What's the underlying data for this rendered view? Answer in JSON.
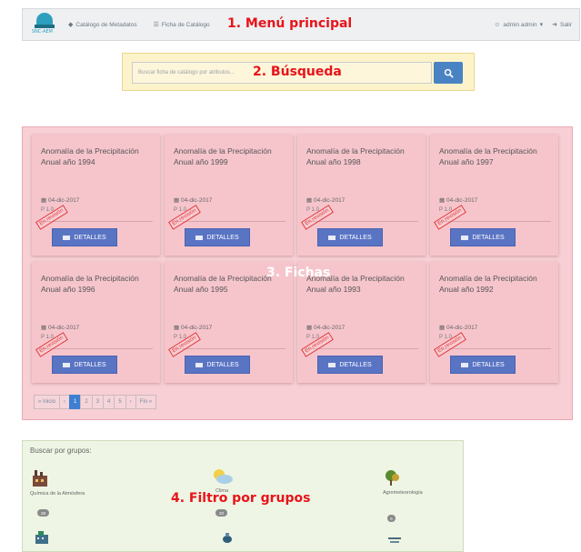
{
  "navbar": {
    "logo_text": "SNC-AEM",
    "items": [
      {
        "icon": "tag-icon",
        "label": "Catálogo de Metadatos"
      },
      {
        "icon": "list-icon",
        "label": "Ficha de Catálogo"
      }
    ],
    "user_label": "admin admin",
    "logout_label": "Salir"
  },
  "annotations": {
    "menu": "1. Menú principal",
    "search": "2. Búsqueda",
    "fichas": "3. Fichas",
    "filter": "4. Filtro por grupos"
  },
  "search": {
    "placeholder": "Buscar ficha de catálogo por atributos...",
    "button_icon": "search-icon"
  },
  "fichas": [
    {
      "title": "Anomalía de la Precipitación Anual año 1994",
      "date": "04-dic-2017",
      "version": "P 1.0",
      "stamp": "En revisión",
      "button": "DETALLES"
    },
    {
      "title": "Anomalía de la Precipitación Anual año 1999",
      "date": "04-dic-2017",
      "version": "P 1.0",
      "stamp": "En revisión",
      "button": "DETALLES"
    },
    {
      "title": "Anomalía de la Precipitación Anual año 1998",
      "date": "04-dic-2017",
      "version": "P 1.0",
      "stamp": "En revisión",
      "button": "DETALLES"
    },
    {
      "title": "Anomalía de la Precipitación Anual año 1997",
      "date": "04-dic-2017",
      "version": "P 1.0",
      "stamp": "En revisión",
      "button": "DETALLES"
    },
    {
      "title": "Anomalía de la Precipitación Anual año 1996",
      "date": "04-dic-2017",
      "version": "P 1.0",
      "stamp": "En revisión",
      "button": "DETALLES"
    },
    {
      "title": "Anomalía de la Precipitación Anual año 1995",
      "date": "04-dic-2017",
      "version": "P 1.0",
      "stamp": "En revisión",
      "button": "DETALLES"
    },
    {
      "title": "Anomalía de la Precipitación Anual año 1993",
      "date": "04-dic-2017",
      "version": "P 1.0",
      "stamp": "En revisión",
      "button": "DETALLES"
    },
    {
      "title": "Anomalía de la Precipitación Anual año 1992",
      "date": "04-dic-2017",
      "version": "P 1.0",
      "stamp": "En revisión",
      "button": "DETALLES"
    }
  ],
  "pagination": {
    "first": "« Inicio",
    "prev": "‹",
    "pages": [
      "1",
      "2",
      "3",
      "4",
      "5"
    ],
    "active": "1",
    "next": "›",
    "last": "Fin »"
  },
  "groups": {
    "title": "Buscar por grupos:",
    "items": [
      {
        "name": "Química de la Atmósfera",
        "count": "28",
        "icon": "factory-icon"
      },
      {
        "name": "Clima",
        "count": "20",
        "icon": "sun-cloud-icon"
      },
      {
        "name": "Agrometeorología",
        "count": "6",
        "icon": "tree-icon"
      },
      {
        "name": "",
        "count": "",
        "icon": "building-icon"
      },
      {
        "name": "",
        "count": "",
        "icon": "satellite-icon"
      },
      {
        "name": "",
        "count": "",
        "icon": "sea-icon"
      }
    ]
  },
  "colors": {
    "navbar_bg": "#eef0f2",
    "search_bg": "#fdf3cb",
    "fichas_bg": "#f7cfd4",
    "groups_bg": "#eef5e4",
    "accent_blue": "#4a83c3",
    "annotation_red": "#e8131a"
  }
}
